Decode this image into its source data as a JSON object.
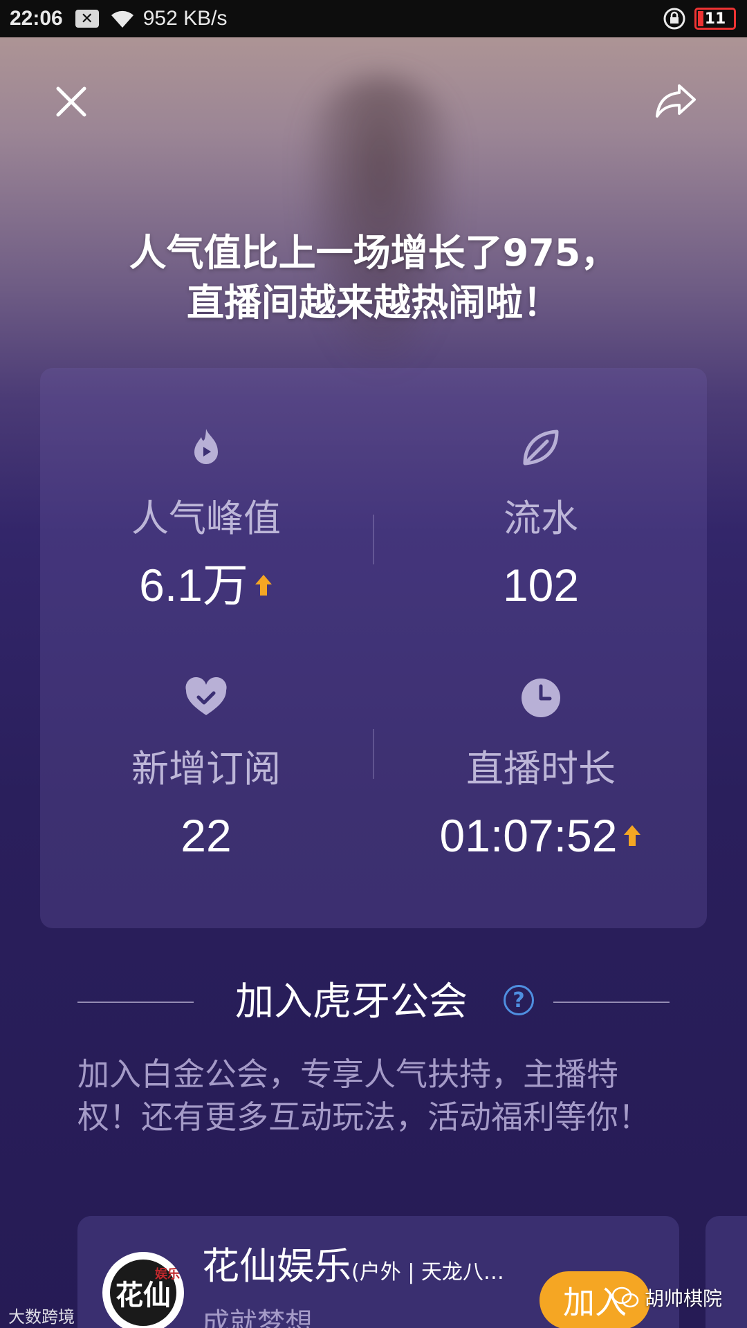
{
  "status_bar": {
    "time": "22:06",
    "notif_icon": "x-box-icon",
    "network_speed": "952 KB/s",
    "battery_level": "11",
    "battery_color": "#e33333"
  },
  "header": {
    "close_icon": "close-icon",
    "share_icon": "share-arrow-icon",
    "headline_line1": "人气值比上一场增长了975，",
    "headline_line2": "直播间越来越热闹啦！"
  },
  "stats": {
    "peak_popularity": {
      "label": "人气峰值",
      "value": "6.1万",
      "icon": "flame-play-icon",
      "trend": "up"
    },
    "revenue": {
      "label": "流水",
      "value": "102",
      "icon": "leaf-icon"
    },
    "new_subscriptions": {
      "label": "新增订阅",
      "value": "22",
      "icon": "heart-check-icon"
    },
    "live_duration": {
      "label": "直播时长",
      "value": "01:07:52",
      "icon": "clock-icon",
      "trend": "up"
    }
  },
  "guild_section": {
    "title": "加入虎牙公会",
    "help_label": "?",
    "description": "加入白金公会，专享人气扶持，主播特权！还有更多互动玩法，活动福利等你！"
  },
  "guild_card": {
    "name": "花仙娱乐",
    "tags": "(户外 | 天龙八…",
    "subtitle": "成就梦想",
    "logo_text": "花仙",
    "logo_badge": "娱乐",
    "join_label": "加入"
  },
  "watermarks": {
    "left": "大数跨境",
    "right": "胡帅棋院"
  },
  "colors": {
    "accent_orange": "#f5a623",
    "help_blue": "#4f8fe0"
  }
}
